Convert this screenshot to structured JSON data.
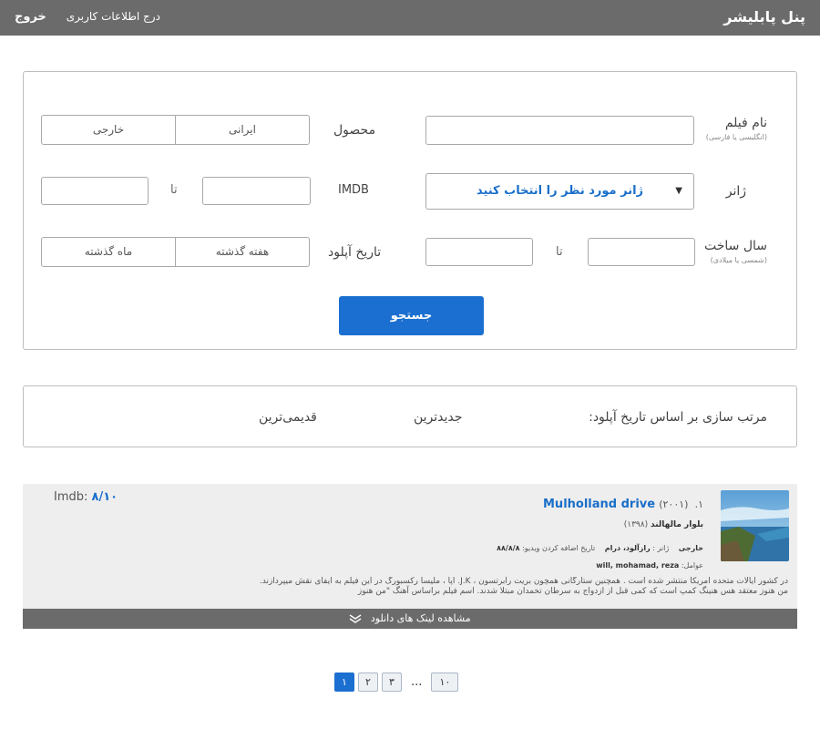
{
  "header": {
    "title": "پنل پابلیشر",
    "profile_link": "درج اطلاعات کاربری",
    "logout_link": "خروج"
  },
  "search": {
    "film_name_label": "نام فیلم",
    "film_name_hint": "(انگلیسی یا فارسی)",
    "product_label": "محصول",
    "product_options": [
      "ایرانی",
      "خارجی"
    ],
    "genre_label": "ژانر",
    "genre_placeholder": "ژانر مورد نظر را انتخاب کنید",
    "imdb_label": "IMDB",
    "to_label": "تا",
    "year_label": "سال ساخت",
    "year_hint": "(شمسی یا میلادی)",
    "upload_label": "تاریخ آپلود",
    "upload_options": [
      "هفته گذشته",
      "ماه گذشته"
    ],
    "search_button": "جستجو"
  },
  "sort": {
    "label": "مرتب سازی بر اساس تاریخ آپلود:",
    "newest": "جدیدترین",
    "oldest": "قدیمی‌ترین"
  },
  "film": {
    "number": "۱.",
    "title_en": "Mulholland drive",
    "year": "(۲۰۰۱)",
    "title_fa": "بلوار مالهالند",
    "title_fa_year": "(۱۳۹۸)",
    "origin": "خارجی",
    "genre_label": "ژانر :",
    "genre": "رازآلود، درام",
    "added_label": "تاریخ اضافه کردن ویدیو:",
    "added_date": "۸۸/۸/۸",
    "crew_label": "عوامل:",
    "crew": "will, mohamad, reza",
    "description_line1": "در کشور ایالات متحده امریکا منتشر شده است . همچنین ستارگانی همچون بریت رابرتسون ، J.K. آپا ، ملیسا رکسبورگ در این فیلم به ایفای نقش میپردازند.",
    "description_line2": "من هنوز معتقد هس هنینگ کمپ است که کمی قبل از ازدواج به سرطان تخمدان مبتلا شدند. اسم فیلم براساس آهنگ \"من هنوز",
    "imdb_label": "Imdb:",
    "imdb_score": "۸/۱۰",
    "download_bar": "مشاهده لینک های دانلود",
    "chevron_icon": "double-chevron-down-icon"
  },
  "pagination": {
    "pages": [
      "۱",
      "۲",
      "۳"
    ],
    "ellipsis": "...",
    "last_page": "۱۰",
    "active_page": "۱"
  },
  "colors": {
    "accent": "#1b6fd0",
    "header_bg": "#6b6b6b",
    "card_bg": "#eeeeee"
  }
}
